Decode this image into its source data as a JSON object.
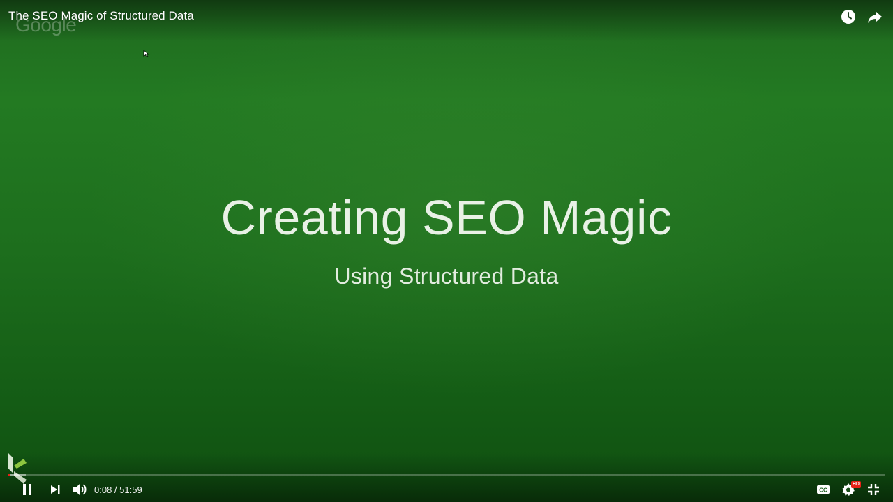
{
  "video": {
    "title": "The SEO Magic of Structured Data",
    "watermark": "Google"
  },
  "slide": {
    "title": "Creating SEO Magic",
    "subtitle": "Using Structured Data"
  },
  "player": {
    "current_time": "0:08",
    "duration": "51:59",
    "time_separator": " / ",
    "progress_fraction": 0.0026,
    "loaded_fraction": 0.02,
    "hd_label": "HD",
    "icons": {
      "watch_later": "clock-icon",
      "share": "share-arrow-icon",
      "pause": "pause-icon",
      "next": "next-icon",
      "volume": "volume-icon",
      "captions": "cc-icon",
      "settings": "gear-icon",
      "exit_fullscreen": "exit-fullscreen-icon"
    },
    "colors": {
      "progress_played": "#e62117",
      "slide_background": "#1f6a1f"
    }
  }
}
